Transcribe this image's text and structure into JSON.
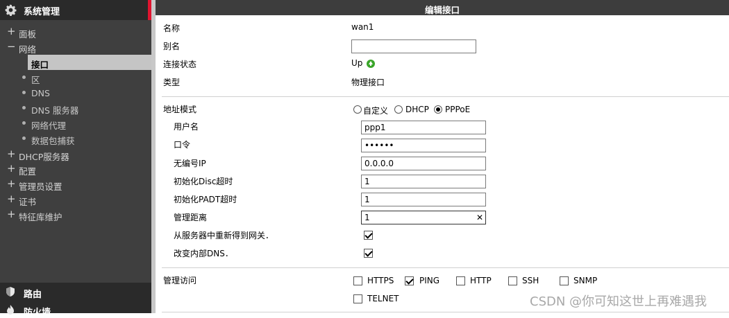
{
  "sidebar": {
    "header": "系统管理",
    "items": [
      {
        "sign": "+",
        "label": "面板"
      },
      {
        "sign": "−",
        "label": "网络"
      },
      {
        "sign": "+",
        "label": "DHCP服务器"
      },
      {
        "sign": "+",
        "label": "配置"
      },
      {
        "sign": "+",
        "label": "管理员设置"
      },
      {
        "sign": "+",
        "label": "证书"
      },
      {
        "sign": "+",
        "label": "特征库维护"
      }
    ],
    "network_subitems": [
      "接口",
      "区",
      "DNS",
      "DNS 服务器",
      "网络代理",
      "数据包捕获"
    ],
    "bottom": [
      {
        "label": "路由",
        "icon": "shield-icon"
      },
      {
        "label": "防火墙",
        "icon": "fire-icon"
      }
    ]
  },
  "main": {
    "title": "编辑接口",
    "name_label": "名称",
    "name_value": "wan1",
    "alias_label": "别名",
    "alias_value": "",
    "status_label": "连接状态",
    "status_value": "Up",
    "type_label": "类型",
    "type_value": "物理接口",
    "addr_mode_label": "地址模式",
    "addr_modes": [
      "自定义",
      "DHCP",
      "PPPoE"
    ],
    "addr_mode_selected": "PPPoE",
    "username_label": "用户名",
    "username_value": "ppp1",
    "password_label": "口令",
    "password_value": "••••••",
    "unnumbered_ip_label": "无编号IP",
    "unnumbered_ip_value": "0.0.0.0",
    "init_disc_label": "初始化Disc超时",
    "init_disc_value": "1",
    "init_padt_label": "初始化PADT超时",
    "init_padt_value": "1",
    "distance_label": "管理距离",
    "distance_value": "1",
    "gateway_label": "从服务器中重新得到网关．",
    "gateway_checked": true,
    "dns_label": "改变内部DNS．",
    "dns_checked": true,
    "admin_access_label": "管理访问",
    "admin_access": [
      {
        "label": "HTTPS",
        "checked": false
      },
      {
        "label": "PING",
        "checked": true
      },
      {
        "label": "HTTP",
        "checked": false
      },
      {
        "label": "SSH",
        "checked": false
      },
      {
        "label": "SNMP",
        "checked": false
      },
      {
        "label": "TELNET",
        "checked": false
      }
    ]
  },
  "watermark": "CSDN @你可知这世上再难遇我",
  "colors": {
    "accent": "#e0142f",
    "sidebar_bg": "#3f3f3f",
    "titlebar_bg": "#3d3d3d",
    "up_green": "#3aa52a"
  }
}
